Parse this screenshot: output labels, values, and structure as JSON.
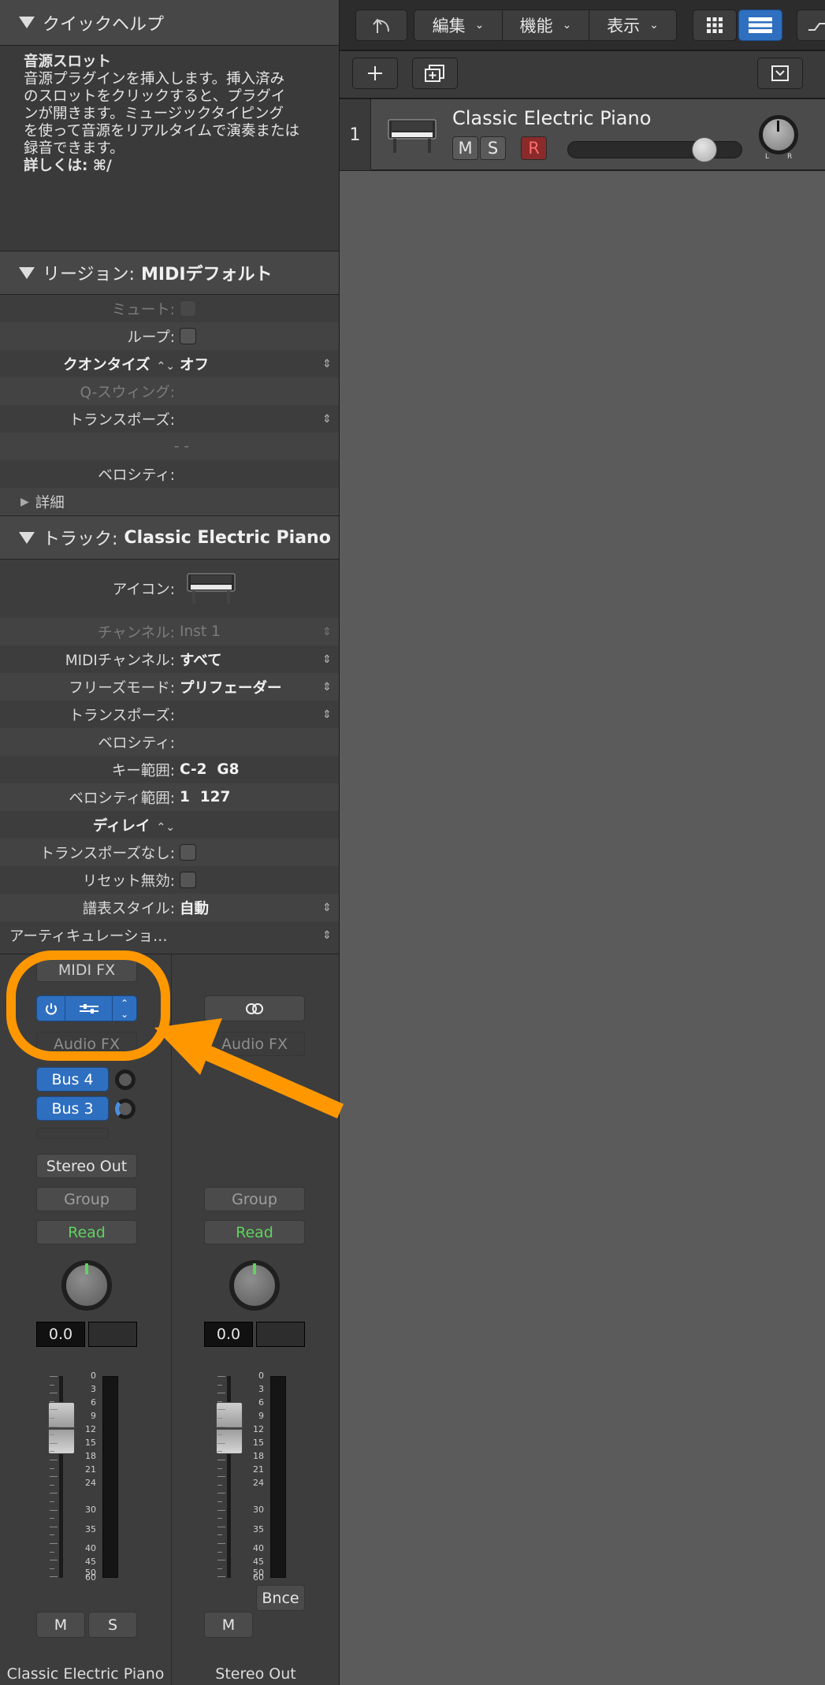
{
  "quick_help": {
    "header": "クイックヘルプ",
    "title": "音源スロット",
    "lines": [
      "音源プラグインを挿入します。挿入済み",
      "のスロットをクリックすると、プラグイ",
      "ンが開きます。ミュージックタイピング",
      "を使って音源をリアルタイムで演奏または",
      "録音できます。"
    ],
    "more": "詳しくは: ⌘/"
  },
  "region": {
    "header_prefix": "リージョン:",
    "header_name": "MIDIデフォルト",
    "mute_label": "ミュート:",
    "loop_label": "ループ:",
    "quantize_label": "クオンタイズ",
    "quantize_value": "オフ",
    "qswing_label": "Q-スウィング:",
    "transpose_label": "トランスポーズ:",
    "dashes": "- -",
    "velocity_label": "ベロシティ:",
    "details_label": "詳細"
  },
  "track": {
    "header_prefix": "トラック:",
    "header_name": "Classic Electric Piano",
    "icon_label": "アイコン:",
    "channel_label": "チャンネル:",
    "channel_value": "Inst 1",
    "midi_channel_label": "MIDIチャンネル:",
    "midi_channel_value": "すべて",
    "freeze_label": "フリーズモード:",
    "freeze_value": "プリフェーダー",
    "transpose_label": "トランスポーズ:",
    "velocity_label": "ベロシティ:",
    "key_range_label": "キー範囲:",
    "key_range_value": "C-2  G8",
    "vel_range_label": "ベロシティ範囲:",
    "vel_range_value": "1  127",
    "delay_label": "ディレイ",
    "no_transpose_label": "トランスポーズなし:",
    "no_reset_label": "リセット無効:",
    "staff_label": "譜表スタイル:",
    "staff_value": "自動",
    "articulation_label": "アーティキュレーショ…"
  },
  "mixer": {
    "strip1": {
      "midi_fx": "MIDI FX",
      "audio_fx": "Audio FX",
      "sends": [
        "Bus 4",
        "Bus 3"
      ],
      "output": "Stereo Out",
      "group": "Group",
      "automation": "Read",
      "volume": "0.0",
      "mute": "M",
      "solo": "S",
      "name": "Classic Electric Piano"
    },
    "strip2": {
      "audio_fx": "Audio FX",
      "group": "Group",
      "automation": "Read",
      "volume": "0.0",
      "bounce": "Bnce",
      "mute": "M",
      "name": "Stereo Out"
    },
    "meter_scale": [
      "0",
      "3",
      "6",
      "9",
      "12",
      "15",
      "18",
      "21",
      "24",
      "30",
      "35",
      "40",
      "45",
      "50",
      "60"
    ]
  },
  "toolbar": {
    "edit": "編集",
    "functions": "機能",
    "view": "表示"
  },
  "track_header": {
    "number": "1",
    "name": "Classic Electric Piano",
    "mute": "M",
    "solo": "S",
    "record": "R",
    "pan_l": "L",
    "pan_r": "R",
    "volume_level": 0.78
  },
  "colors": {
    "accent_blue": "#2f6fc0",
    "highlight_orange": "#ff9800",
    "read_green": "#5fd35f"
  }
}
